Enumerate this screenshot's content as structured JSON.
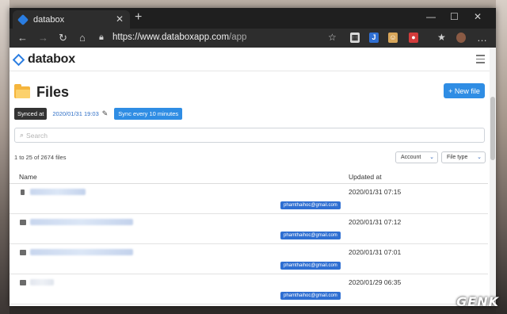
{
  "browser": {
    "tab_title": "databox",
    "url_host": "https://www.databoxapp.com",
    "url_path": "/app",
    "icons": [
      "back-arrow",
      "forward-arrow",
      "reload",
      "home",
      "lock",
      "star",
      "extension",
      "favorites",
      "profile",
      "menu"
    ]
  },
  "app": {
    "logo_text": "databox",
    "page_title": "Files",
    "new_file_label": "+ New file",
    "synced_label": "Synced at",
    "synced_date": "2020/01/31 19:03",
    "sync_badge": "Sync every 10 minutes",
    "search_placeholder": "Search",
    "count_text": "1 to 25 of 2674 files",
    "filter_account": "Account",
    "filter_filetype": "File type",
    "columns": {
      "name": "Name",
      "updated": "Updated at"
    },
    "rows": [
      {
        "icon": "document-icon",
        "owner": "phamthaihoc@gmail.com",
        "updated": "2020/01/31 07:15"
      },
      {
        "icon": "shared-folder-icon",
        "owner": "phamthaihoc@gmail.com",
        "updated": "2020/01/31 07:12"
      },
      {
        "icon": "shared-folder-icon",
        "owner": "phamthaihoc@gmail.com",
        "updated": "2020/01/31 07:01"
      },
      {
        "icon": "folder-icon",
        "owner": "phamthaihoc@gmail.com",
        "updated": "2020/01/29 06:35"
      }
    ]
  },
  "watermark": "GENK",
  "colors": {
    "accent": "#2f8de4",
    "badge": "#2f6fd2",
    "folder": "#f5b53d"
  }
}
